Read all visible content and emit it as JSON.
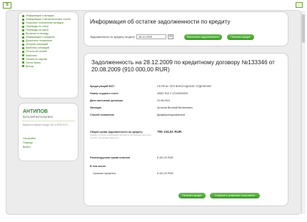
{
  "menu": [
    "Информация о вкладах",
    "Информация о металлических счетах",
    "Открытие/ пополнение вкладов",
    "Переводы по счету",
    "Переводы на карту",
    "Выписка по вкладу",
    "Информация о кредитах",
    "Досрочное погашение",
    "История операций",
    "Шаблоны операций",
    "Отчеты об оплате",
    "Шаблоны",
    "Оплата по картам",
    "Почта банка",
    "Выход"
  ],
  "user": {
    "name": "АНТИПОВ",
    "subname": "ВИТАЛИЙ ВИТАЛЬЕВИЧ",
    "info": "Время последнего входа: 28.12.2009 13:17",
    "links": [
      "Настройки",
      "Помощь",
      "Выйти"
    ]
  },
  "filter": {
    "title": "Информация об остатке задолженности по кредиту",
    "date_label": "Задолженность по кредиту на дату*",
    "date_value": "28.12.2009",
    "display_button": "Выполнить задолженность",
    "print_button": "Печатать кредит"
  },
  "main": {
    "title": "Задолженность на 28.12.2009 по кредитному договору №133346 от 20.08.2009 (910 000,00 RUR)",
    "rows": [
      {
        "label": "Кредитующий ВСП",
        "value": "СБ РФ № 7870 ВОЛОГОДСКОЕ ОТДЕЛЕНИЕ"
      },
      {
        "label": "Номер ссудного счета",
        "value": "45507 810 2 12140000000"
      },
      {
        "label": "Дата окончания договора",
        "value": "20.08.2024"
      },
      {
        "label": "Заемщик",
        "value": "Антипов Виталий Витальевич"
      },
      {
        "label": "Способ погашения",
        "value": "Дифференцированный"
      },
      {
        "label": "Общая сумма задолженности по кредиту",
        "note": "(сумма, которую необходимо заплатить на текущую дату для полного погашения кредита)",
        "value": "795 134,51 RUR"
      },
      {
        "label": "Рекомендуемая сумма платежа",
        "value": "8 401,29 RUR"
      },
      {
        "label": "В том числе:",
        "value": ""
      },
      {
        "label": "Срочные проценты",
        "value": "8 401,29 RUR"
      }
    ],
    "print_button": "Печатать кредит",
    "save_button": "Сохранить реквизиты получателя"
  }
}
